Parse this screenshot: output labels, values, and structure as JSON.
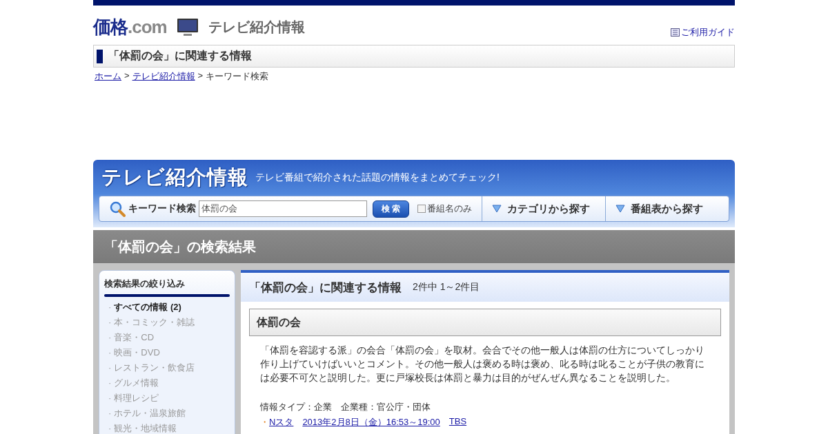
{
  "header": {
    "logo_main": "価格",
    "logo_suffix": ".com",
    "section_title": "テレビ紹介情報",
    "guide_link": "ご利用ガイド"
  },
  "page_title": "「体罰の会」に関連する情報",
  "breadcrumb": [
    {
      "label": "ホーム",
      "link": true
    },
    {
      "label": "テレビ紹介情報",
      "link": true
    },
    {
      "label": "キーワード検索",
      "link": false
    }
  ],
  "breadcrumb_separator": ">",
  "banner": {
    "title": "テレビ紹介情報",
    "tagline": "テレビ番組で紹介された話題の情報をまとめてチェック!",
    "search_label": "キーワード検索",
    "search_value": "体罰の会",
    "search_button": "検 索",
    "program_only": {
      "label": "番組名のみ",
      "checked": false
    },
    "category_button": "カテゴリから探す",
    "schedule_button": "番組表から探す"
  },
  "results_title": "「体罰の会」の検索結果",
  "sidebar": {
    "title": "検索結果の絞り込み",
    "bullet": "·",
    "items": [
      {
        "label": "すべての情報 (2)",
        "selected": true
      },
      {
        "label": "本・コミック・雑誌",
        "selected": false
      },
      {
        "label": "音楽・CD",
        "selected": false
      },
      {
        "label": "映画・DVD",
        "selected": false
      },
      {
        "label": "レストラン・飲食店",
        "selected": false
      },
      {
        "label": "グルメ情報",
        "selected": false
      },
      {
        "label": "料理レシピ",
        "selected": false
      },
      {
        "label": "ホテル・温泉旅館",
        "selected": false
      },
      {
        "label": "観光・地域情報",
        "selected": false
      }
    ]
  },
  "main": {
    "title": "「体罰の会」に関連する情報",
    "count": "2件中 1～2件目",
    "entries": [
      {
        "heading": "体罰の会",
        "description": "「体罰を容認する派」の会合「体罰の会」を取材。会合でその他一般人は体罰の仕方についてしっかり作り上げていけばいいとコメント。その他一般人は褒める時は褒め、叱る時は叱ることが子供の教育には必要不可欠と説明した。更に戸塚校長は体罰と暴力は目的がぜんぜん異なることを説明した。",
        "info": "情報タイプ：企業　企業種：官公庁・団体",
        "bullet": "・",
        "program": "Nスタ",
        "airtime": "2013年2月8日（金）16:53～19:00",
        "channel": "TBS"
      }
    ]
  }
}
